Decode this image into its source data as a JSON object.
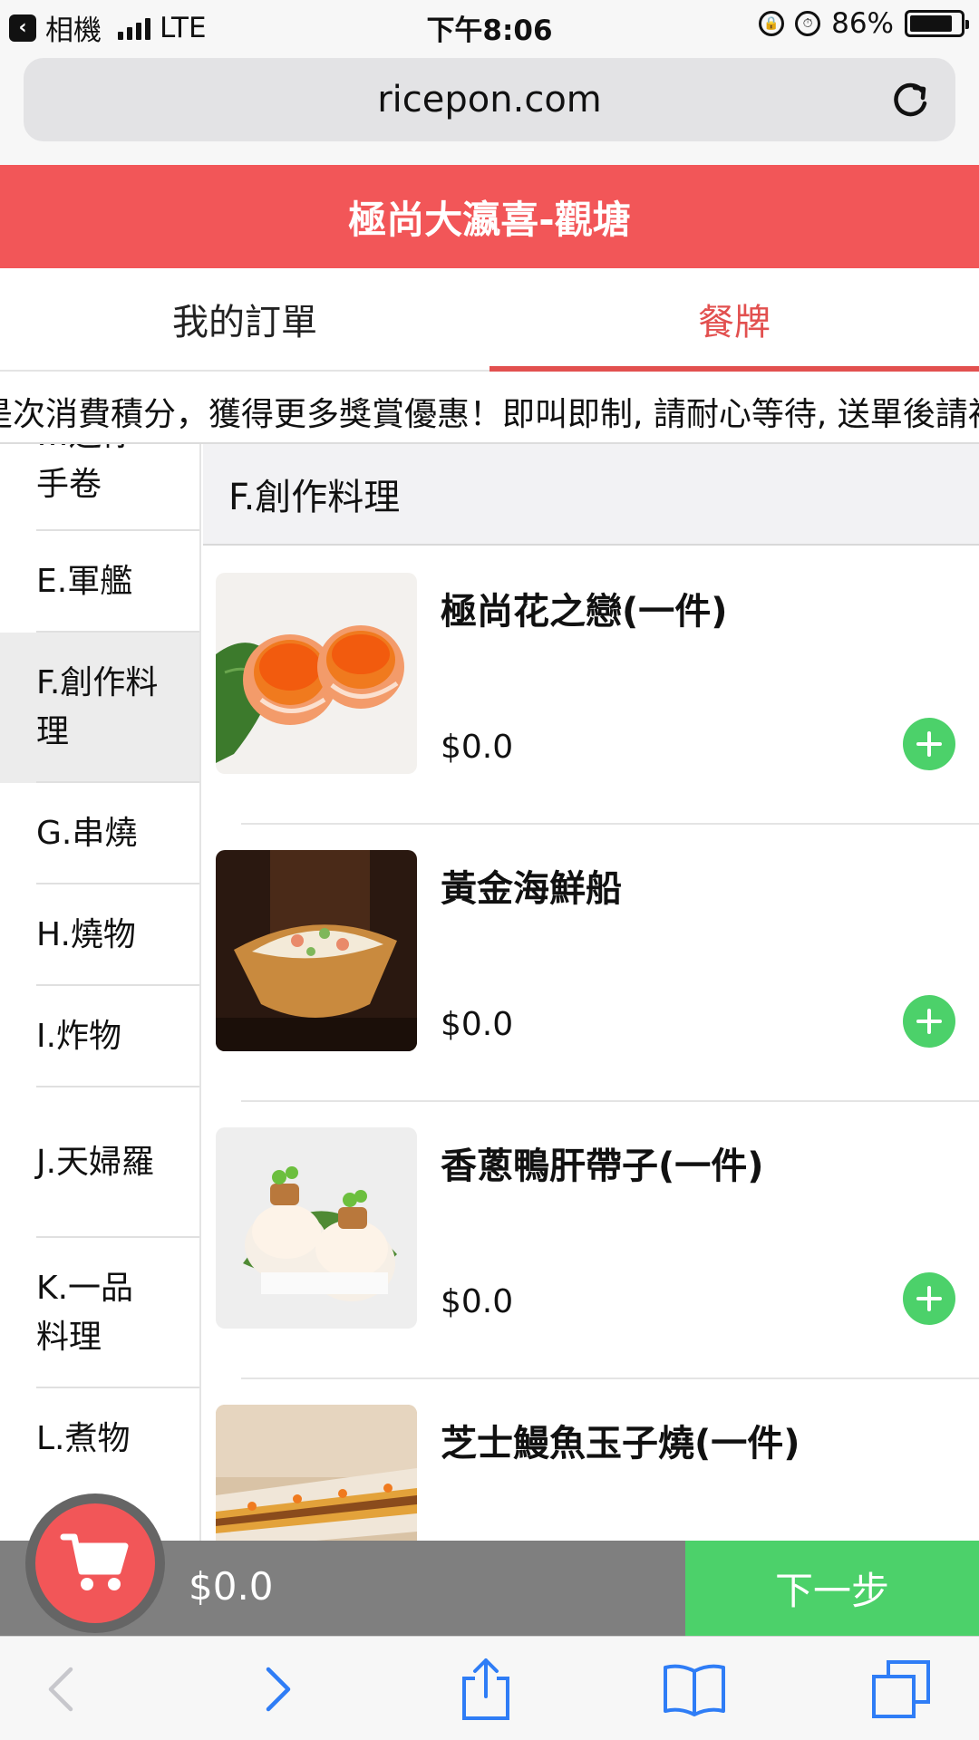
{
  "status_bar": {
    "back_app": "相機",
    "network": "LTE",
    "time": "下午8:06",
    "battery": "86%",
    "battery_level": 0.86
  },
  "browser": {
    "url": "ricepon.com",
    "icons": [
      "reload-icon",
      "back-icon",
      "forward-icon",
      "share-icon",
      "bookmarks-icon",
      "tabs-icon"
    ]
  },
  "header": {
    "title": "極尚大瀛喜-觀塘"
  },
  "tabs": [
    {
      "label": "我的訂單",
      "active": false
    },
    {
      "label": "餐牌",
      "active": true
    }
  ],
  "marquee": {
    "text": "是次消費積分，獲得更多獎賞優惠！即叫即制, 請耐心等待, 送單後請衫"
  },
  "categories": [
    {
      "label": "…迷你"
    },
    {
      "label": "手卷"
    },
    {
      "label": "E.軍艦"
    },
    {
      "label": "F.創作料理",
      "active": true
    },
    {
      "label": "G.串燒"
    },
    {
      "label": "H.燒物"
    },
    {
      "label": "I.炸物"
    },
    {
      "label": "J.天婦羅"
    },
    {
      "label": "K.一品料理"
    },
    {
      "label": "L.煮物"
    }
  ],
  "section": {
    "title": "F.創作料理"
  },
  "items": [
    {
      "name": "極尚花之戀(一件)",
      "price": "$0.0",
      "image": "salmon-roe-rolls"
    },
    {
      "name": "黃金海鮮船",
      "price": "$0.0",
      "image": "seafood-tofu-boat"
    },
    {
      "name": "香蔥鴨肝帶子(一件)",
      "price": "$0.0",
      "image": "scallop-foie-gras-sushi"
    },
    {
      "name": "芝士鰻魚玉子燒(一件)",
      "price": "",
      "image": "cheese-eel-tamago"
    }
  ],
  "cart": {
    "total": "$0.0",
    "next_label": "下一步"
  },
  "colors": {
    "brand_red": "#f25658",
    "active_tab": "#e2504f",
    "green": "#4cd16a",
    "cart_gray": "#7f7f7f"
  }
}
